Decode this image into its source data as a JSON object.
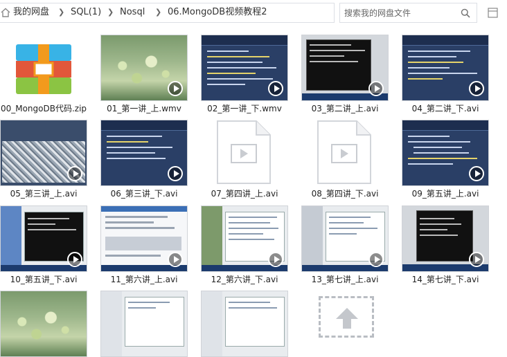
{
  "breadcrumb": {
    "items": [
      "我的网盘",
      "SQL(1)",
      "Nosql",
      "06.MongoDB视频教程2"
    ]
  },
  "search": {
    "placeholder": "搜索我的网盘文件"
  },
  "files": [
    {
      "name": "00_MongoDB代码.zip",
      "kind": "zip"
    },
    {
      "name": "01_第一讲_上.wmv",
      "kind": "video",
      "thumb": "green"
    },
    {
      "name": "02_第一讲_下.wmv",
      "kind": "video",
      "thumb": "blue"
    },
    {
      "name": "03_第二讲_上.avi",
      "kind": "video",
      "thumb": "term"
    },
    {
      "name": "04_第二讲_下.avi",
      "kind": "video",
      "thumb": "blue"
    },
    {
      "name": "05_第三讲_上.avi",
      "kind": "video",
      "thumb": "dots"
    },
    {
      "name": "06_第三讲_下.avi",
      "kind": "video",
      "thumb": "blue"
    },
    {
      "name": "07_第四讲_上.avi",
      "kind": "video-placeholder"
    },
    {
      "name": "08_第四讲_下.avi",
      "kind": "video-placeholder"
    },
    {
      "name": "09_第五讲_上.avi",
      "kind": "video",
      "thumb": "blue"
    },
    {
      "name": "10_第五讲_下.avi",
      "kind": "video",
      "thumb": "ide"
    },
    {
      "name": "11_第六讲_上.avi",
      "kind": "video",
      "thumb": "web"
    },
    {
      "name": "12_第六讲_下.avi",
      "kind": "video",
      "thumb": "ide"
    },
    {
      "name": "13_第七讲_上.avi",
      "kind": "video",
      "thumb": "ide"
    },
    {
      "name": "14_第七讲_下.avi",
      "kind": "video",
      "thumb": "term"
    },
    {
      "name": "",
      "kind": "video",
      "thumb": "green"
    },
    {
      "name": "",
      "kind": "video",
      "thumb": "ide"
    },
    {
      "name": "",
      "kind": "video",
      "thumb": "ide"
    },
    {
      "name": "",
      "kind": "upload"
    }
  ],
  "icons": {
    "home": "home-icon",
    "search": "search-icon",
    "view": "view-toggle-icon",
    "play": "play-icon"
  }
}
